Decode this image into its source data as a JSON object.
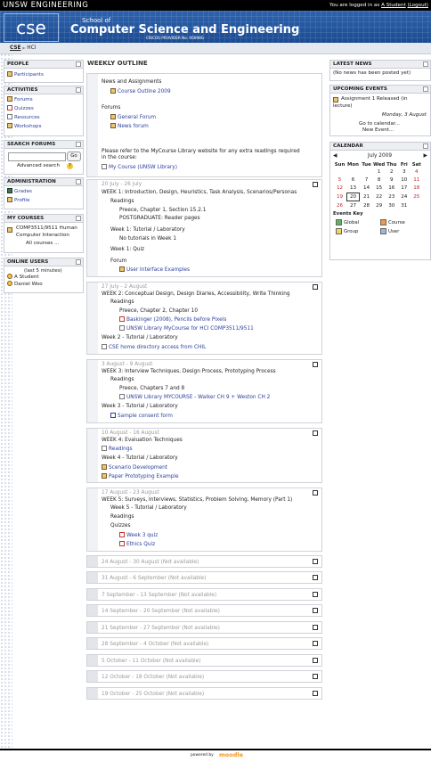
{
  "topbar": {
    "brand": "UNSW ENGINEERING",
    "login_prefix": "You are logged in as",
    "user": "A Student",
    "logout": "(Logout)"
  },
  "banner": {
    "logo": "cse",
    "school": "School of",
    "dept": "Computer Science and Engineering",
    "cricos": "CRICOS PROVIDER No. 00098G"
  },
  "breadcrumb": {
    "home": "CSE",
    "sep": "▶",
    "course": "HCI"
  },
  "left": {
    "people": {
      "title": "PEOPLE",
      "items": [
        "Participants"
      ]
    },
    "activities": {
      "title": "ACTIVITIES",
      "items": [
        "Forums",
        "Quizzes",
        "Resources",
        "Workshops"
      ]
    },
    "search": {
      "title": "SEARCH FORUMS",
      "go": "Go",
      "advanced": "Advanced search",
      "help": "?"
    },
    "admin": {
      "title": "ADMINISTRATION",
      "items": [
        "Grades",
        "Profile"
      ]
    },
    "courses": {
      "title": "MY COURSES",
      "course_line1": "COMP3511/9511 Human",
      "course_line2": "Computer Interaction",
      "all": "All courses ..."
    },
    "online": {
      "title": "ONLINE USERS",
      "sub": "(last 5 minutes)",
      "users": [
        "A Student",
        "Daniel Woo"
      ]
    }
  },
  "main": {
    "title": "WEEKLY OUTLINE",
    "intro": {
      "h1": "News and Assignments",
      "l1": "Course Outline 2009",
      "h2": "Forums",
      "l2": "General Forum",
      "l3": "News forum",
      "p1": "Please refer to the MyCourse Library website for any extra readings required",
      "p2": "in the course:",
      "l4": "My Course (UNSW Library)"
    },
    "week1": {
      "date": "20 July - 26 July",
      "t1": "WEEK 1: Introduction, Design, Heuristics, Task Analysis, Scenarios/Personas",
      "t2": "Readings",
      "t3": "Preece, Chapter 1, Section 15.2.1",
      "t4": "POSTGRADUATE: Reader pages",
      "t5": "Week 1: Tutorial / Laboratory",
      "t6": "No tutorials in Week 1",
      "t7": "Week 1: Quiz",
      "t8": "Forum",
      "t9": "User Interface Examples"
    },
    "week2": {
      "date": "27 July - 2 August",
      "t1": "WEEK 2: Conceptual Design, Design Diaries, Accessibility, Write Thinking",
      "t2": "Readings",
      "t3": "Preece, Chapter 2, Chapter 10",
      "t4": "Baskinger (2008), Pencils before Pixels",
      "t5": "UNSW Library MyCourse for HCI COMP3511/9511",
      "t6": "Week 2 - Tutorial / Laboratory",
      "t7": "CSE home directory access from CHIL"
    },
    "week3": {
      "date": "3 August - 9 August",
      "t1": "WEEK 3: Interview Techniques, Design Process, Prototyping Process",
      "t2": "Readings",
      "t3": "Preece, Chapters 7 and 8",
      "t4": "UNSW Library MYCOURSE - Walker CH 9 + Weston CH 2",
      "t5": "Week 3 - Tutorial / Laboratory",
      "t6": "Sample consent form"
    },
    "week4": {
      "date": "10 August - 16 August",
      "t1": "WEEK 4: Evaluation Techniques",
      "t2": "Readings",
      "t3": "Week 4 - Tutorial / Laboratory",
      "t4": "Scenario Development",
      "t5": "Paper Prototyping Example"
    },
    "week5": {
      "date": "17 August - 23 August",
      "t1": "WEEK 5: Surveys, Interviews, Statistics, Problem Solving, Memory (Part 1)",
      "t2": "Week 5 - Tutorial / Laboratory",
      "t3": "Readings",
      "t4": "Quizzes",
      "t5": "Week 3 quiz",
      "t6": "Ethics Quiz"
    },
    "unavailable": [
      "24 August - 30 August (Not available)",
      "31 August - 6 September (Not available)",
      "7 September - 13 September (Not available)",
      "14 September - 20 September (Not available)",
      "21 September - 27 September (Not available)",
      "28 September - 4 October (Not available)",
      "5 October - 11 October (Not available)",
      "12 October - 18 October (Not available)",
      "19 October - 25 October (Not available)"
    ]
  },
  "right": {
    "news": {
      "title": "LATEST NEWS",
      "text": "(No news has been posted yet)"
    },
    "events": {
      "title": "UPCOMING EVENTS",
      "e1": "Assignment 1 Released (in",
      "e2": "lecture)",
      "date": "Monday, 3 August",
      "goto": "Go to calendar...",
      "new": "New Event..."
    },
    "calendar": {
      "title": "CALENDAR",
      "month": "July 2009",
      "prev": "◀",
      "next": "▶",
      "days": [
        "Sun",
        "Mon",
        "Tue",
        "Wed",
        "Thu",
        "Fri",
        "Sat"
      ],
      "weeks": [
        [
          "",
          "",
          "",
          "1",
          "2",
          "3",
          "4"
        ],
        [
          "5",
          "6",
          "7",
          "8",
          "9",
          "10",
          "11"
        ],
        [
          "12",
          "13",
          "14",
          "15",
          "16",
          "17",
          "18"
        ],
        [
          "19",
          "20",
          "21",
          "22",
          "23",
          "24",
          "25"
        ],
        [
          "26",
          "27",
          "28",
          "29",
          "30",
          "31",
          ""
        ]
      ],
      "today": "20",
      "key_title": "Events Key",
      "keys": [
        "Global",
        "Course",
        "Group",
        "User"
      ],
      "key_colors": [
        "#5fb35a",
        "#f29a3c",
        "#f2d55a",
        "#9fb6d8"
      ]
    }
  },
  "footer": {
    "powered": "powered by",
    "moodle": "moodle"
  }
}
